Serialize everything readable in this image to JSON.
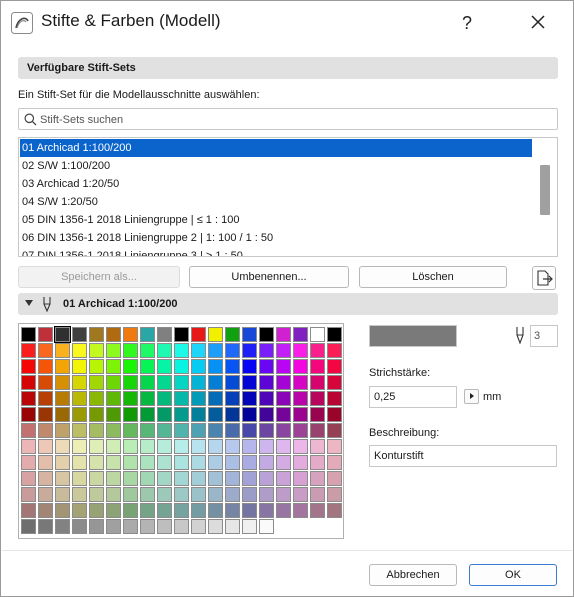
{
  "window": {
    "title": "Stifte & Farben (Modell)",
    "help_label": "?"
  },
  "sets_section": {
    "header": "Verfügbare Stift-Sets",
    "instruction": "Ein Stift-Set für die Modellausschnitte auswählen:",
    "search_placeholder": "Stift-Sets suchen",
    "items": [
      "01 Archicad 1:100/200",
      "02 S/W 1:100/200",
      "03 Archicad 1:20/50",
      "04 S/W 1:20/50",
      "05 DIN 1356-1 2018 Liniengruppe | ≤ 1 : 100",
      "06 DIN 1356-1 2018 Liniengruppe 2 | 1: 100 / 1 : 50",
      "07 DIN 1356-1 2018 Liniengruppe 3 | > 1 : 50"
    ],
    "selected_index": 0
  },
  "actions": {
    "save_as": "Speichern als...",
    "rename": "Umbenennen...",
    "delete": "Löschen"
  },
  "pen_section": {
    "header": "01 Archicad 1:100/200",
    "pen_number": "3",
    "selected_color": "#7a7a7a",
    "stroke_label": "Strichstärke:",
    "stroke_value": "0,25",
    "stroke_unit": "mm",
    "description_label": "Beschreibung:",
    "description_value": "Konturstift"
  },
  "footer": {
    "cancel": "Abbrechen",
    "ok": "OK"
  },
  "colors": {
    "accent": "#0a64cc",
    "header_bg": "#e1e1e1"
  }
}
